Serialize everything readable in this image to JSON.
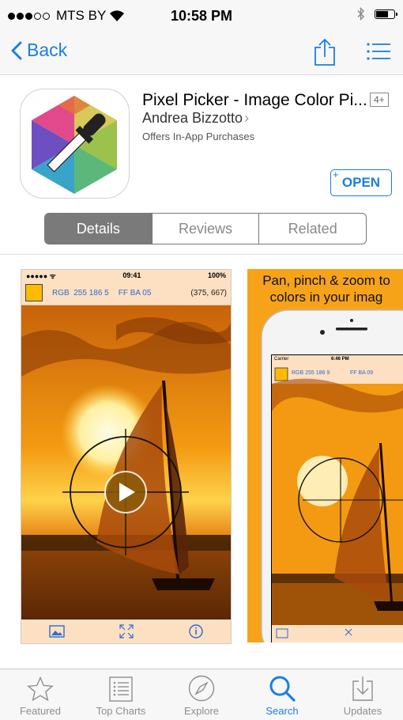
{
  "status": {
    "carrier": "MTS BY",
    "time": "10:58 PM",
    "signal_bars": 3,
    "signal_total": 5,
    "battery_level": 0.7
  },
  "nav": {
    "back_label": "Back",
    "share_icon": "share-icon",
    "list_icon": "list-icon"
  },
  "app": {
    "title": "Pixel Picker - Image Color Pi...",
    "age_rating": "4+",
    "developer": "Andrea Bizzotto",
    "developer_chevron": "›",
    "in_app": "Offers In-App Purchases",
    "open_label": "OPEN",
    "open_plus": "+"
  },
  "segments": [
    "Details",
    "Reviews",
    "Related"
  ],
  "selected_segment": "Details",
  "screenshot1": {
    "status_time": "09:41",
    "status_battery": "100%",
    "rgb_label": "RGB",
    "rgb_values": "255 186 5",
    "hex": "FF BA 05",
    "coords": "(375, 667)"
  },
  "screenshot2": {
    "caption_line1": "Pan, pinch & zoom to",
    "caption_line2": "colors in your imag",
    "carrier": "Carrier",
    "time": "6:46 PM",
    "rgb": "RGB 255 186 9",
    "hex": "FF BA 09"
  },
  "tabs": [
    {
      "label": "Featured",
      "icon": "star-icon"
    },
    {
      "label": "Top Charts",
      "icon": "top-charts-icon"
    },
    {
      "label": "Explore",
      "icon": "compass-icon"
    },
    {
      "label": "Search",
      "icon": "search-icon"
    },
    {
      "label": "Updates",
      "icon": "updates-icon"
    }
  ],
  "active_tab": "Search",
  "colors": {
    "accent": "#1a7fe0",
    "segment_selected": "#7a7a7a",
    "tab_inactive": "#8e8e8e"
  }
}
